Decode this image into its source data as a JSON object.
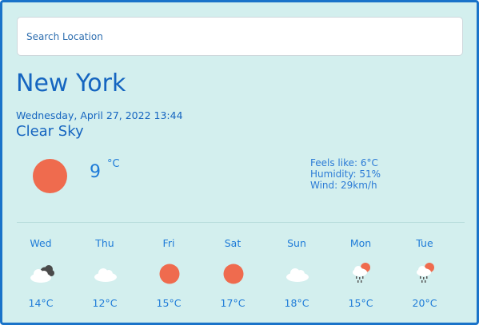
{
  "search": {
    "placeholder": "Search Location"
  },
  "current": {
    "city": "New York",
    "datetime": "Wednesday, April 27, 2022 13:44",
    "condition": "Clear Sky",
    "temperature": "9",
    "unit": "°C",
    "icon": "sun-icon",
    "feels_like": "Feels like: 6°C",
    "humidity": "Humidity: 51%",
    "wind": "Wind: 29km/h"
  },
  "forecast": [
    {
      "day": "Wed",
      "temp": "14°C",
      "icon": "cloud-dark-icon"
    },
    {
      "day": "Thu",
      "temp": "12°C",
      "icon": "cloud-icon"
    },
    {
      "day": "Fri",
      "temp": "15°C",
      "icon": "sun-icon"
    },
    {
      "day": "Sat",
      "temp": "17°C",
      "icon": "sun-icon"
    },
    {
      "day": "Sun",
      "temp": "18°C",
      "icon": "cloud-icon"
    },
    {
      "day": "Mon",
      "temp": "15°C",
      "icon": "rain-sun-icon"
    },
    {
      "day": "Tue",
      "temp": "20°C",
      "icon": "rain-sun-icon"
    }
  ],
  "colors": {
    "background": "#d3efee",
    "border": "#1a73c9",
    "text": "#1565c0",
    "sun": "#ef6b4e",
    "cloud": "#ffffff"
  }
}
